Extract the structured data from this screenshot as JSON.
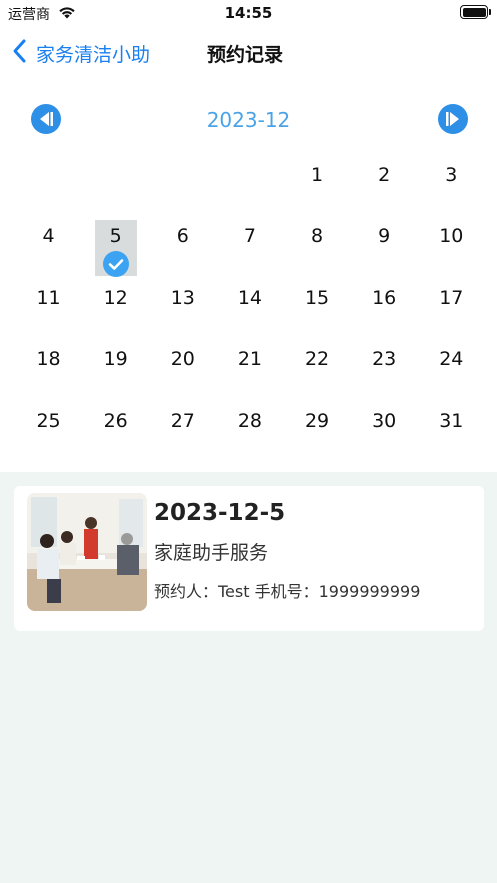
{
  "status_bar": {
    "carrier": "运营商",
    "time": "14:55"
  },
  "nav": {
    "back_label": "家务清洁小助",
    "title": "预约记录"
  },
  "calendar": {
    "month_label": "2023-12",
    "leading_blanks": 4,
    "days_in_month": 31,
    "selected_day": 5,
    "accent_color": "#2e8fe6"
  },
  "records": [
    {
      "date": "2023-12-5",
      "service": "家庭助手服务",
      "contact": "预约人：Test 手机号：1999999999",
      "image": "family-dining-photo"
    }
  ]
}
